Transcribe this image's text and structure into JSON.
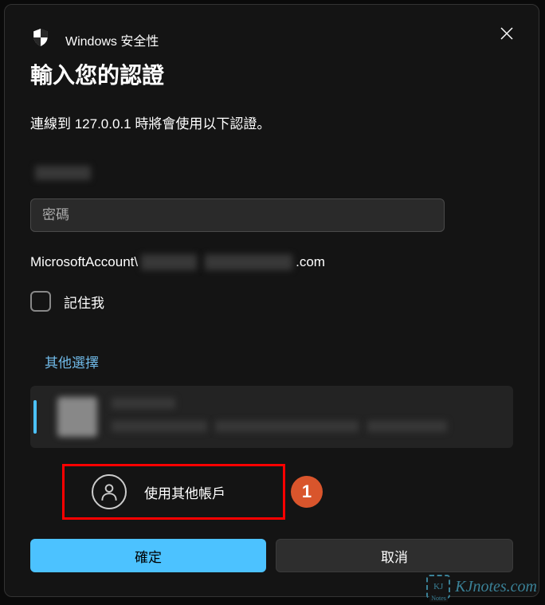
{
  "header": {
    "app_name": "Windows 安全性",
    "title": "輸入您的認證"
  },
  "description": "連線到 127.0.0.1 時將會使用以下認證。",
  "password": {
    "placeholder": "密碼"
  },
  "account_info": {
    "prefix": "MicrosoftAccount\\",
    "suffix": ".com"
  },
  "remember": {
    "label": "記住我"
  },
  "other_choices_label": "其他選擇",
  "use_other_account": {
    "label": "使用其他帳戶"
  },
  "annotation": {
    "number": "1"
  },
  "buttons": {
    "ok": "確定",
    "cancel": "取消"
  },
  "watermark": {
    "text": "KJnotes.com",
    "icon_text": "KJ",
    "icon_sub": "Notes"
  }
}
